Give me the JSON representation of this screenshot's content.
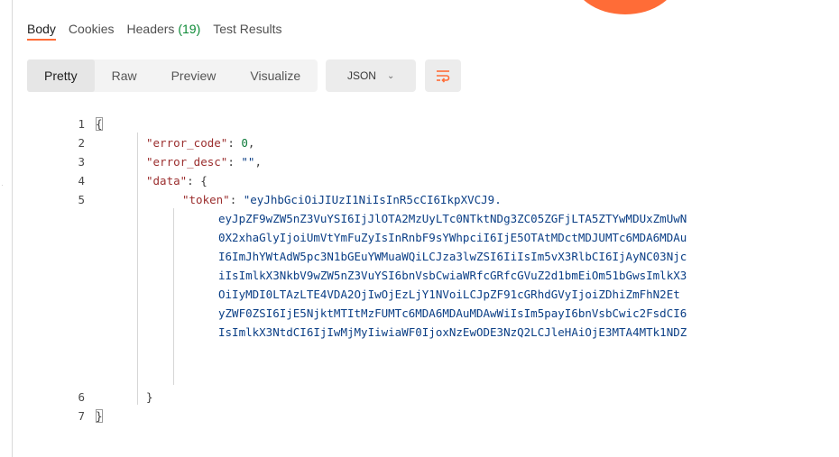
{
  "tabs": [
    {
      "label": "Body",
      "active": true
    },
    {
      "label": "Cookies",
      "active": false
    },
    {
      "label": "Headers",
      "count": "(19)",
      "active": false
    },
    {
      "label": "Test Results",
      "active": false
    }
  ],
  "view_modes": [
    "Pretty",
    "Raw",
    "Preview",
    "Visualize"
  ],
  "active_view": "Pretty",
  "format": {
    "selected": "JSON"
  },
  "wrap_icon": "word-wrap-icon",
  "code": {
    "line_numbers": [
      "1",
      "2",
      "3",
      "4",
      "5",
      "6",
      "7"
    ],
    "l1_open": "{",
    "l2_key": "\"error_code\"",
    "l2_val": "0",
    "l3_key": "\"error_desc\"",
    "l3_val": "\"\"",
    "l4_key": "\"data\"",
    "l4_open": "{",
    "l5_key": "\"token\"",
    "token_lines": [
      "\"eyJhbGciOiJIUzI1NiIsInR5cCI6IkpXVCJ9.",
      "eyJpZF9wZW5nZ3VuYSI6IjJlOTA2MzUyLTc0NTktNDg3ZC05ZGFjLTA5ZTYwMDUxZmUwN",
      "0X2xhaGlyIjoiUmVtYmFuZyIsInRnbF9sYWhpciI6IjE5OTAtMDctMDJUMTc6MDA6MDAu",
      "I6ImJhYWtAdW5pc3N1bGEuYWMuaWQiLCJza3lwZSI6IiIsIm5vX3RlbCI6IjAyNC03Njc",
      "iIsImlkX3NkbV9wZW5nZ3VuYSI6bnVsbCwiaWRfcGRfcGVuZ2d1bmEiOm51bGwsImlkX3",
      "OiIyMDI0LTAzLTE4VDA2OjIwOjEzLjY1NVoiLCJpZF91cGRhdGVyIjoiZDhiZmFhN2Et",
      "yZWF0ZSI6IjE5NjktMTItMzFUMTc6MDA6MDAuMDAwWiIsIm5payI6bnVsbCwic2FsdCI6",
      "IsImlkX3NtdCI6IjIwMjMyIiwiaWF0IjoxNzEwODE3NzQ2LCJleHAiOjE3MTA4MTk1NDZ"
    ],
    "l6_close": "}",
    "l7_close": "}"
  }
}
